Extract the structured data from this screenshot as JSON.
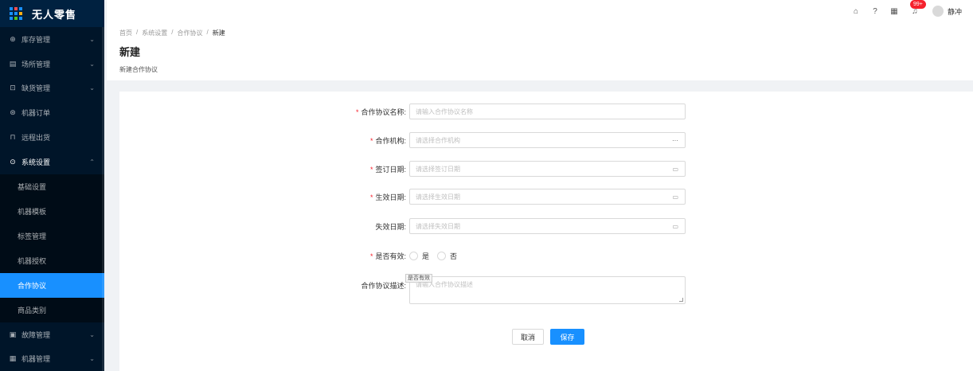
{
  "app": {
    "title": "无人零售"
  },
  "colors": {
    "sidebar_bg": "#001529",
    "accent": "#1890ff",
    "required": "#f5222d"
  },
  "sidebar": {
    "items": [
      {
        "label": "库存管理",
        "icon": "inventory-icon",
        "glyph": "⊕",
        "arrow": "⌄"
      },
      {
        "label": "场所管理",
        "icon": "location-icon",
        "glyph": "▤",
        "arrow": "⌄"
      },
      {
        "label": "缺货管理",
        "icon": "shortage-icon",
        "glyph": "⊡",
        "arrow": "⌄"
      },
      {
        "label": "机器订单",
        "icon": "order-icon",
        "glyph": "⊛",
        "arrow": ""
      },
      {
        "label": "远程出货",
        "icon": "remote-icon",
        "glyph": "⊓",
        "arrow": ""
      },
      {
        "label": "系统设置",
        "icon": "settings-icon",
        "glyph": "⊙",
        "arrow": "⌃"
      }
    ],
    "submenu": [
      {
        "label": "基础设置"
      },
      {
        "label": "机器模板"
      },
      {
        "label": "标签管理"
      },
      {
        "label": "机器授权"
      },
      {
        "label": "合作协议"
      },
      {
        "label": "商品类别"
      }
    ],
    "bottom_items": [
      {
        "label": "故障管理",
        "icon": "fault-icon",
        "glyph": "▣",
        "arrow": "⌄"
      },
      {
        "label": "机器管理",
        "icon": "machine-icon",
        "glyph": "▦",
        "arrow": "⌄"
      }
    ]
  },
  "header": {
    "badge": "99+",
    "username": "静冲",
    "icons": {
      "home": "⌂",
      "help": "?",
      "apps": "▦",
      "bell": "♫"
    }
  },
  "breadcrumb": {
    "b1": "首页",
    "b2": "系统设置",
    "b3": "合作协议",
    "b4": "新建",
    "sep": "/"
  },
  "page": {
    "title": "新建",
    "desc": "新建合作协议"
  },
  "form": {
    "name": {
      "label": "合作协议名称:",
      "placeholder": "请输入合作协议名称"
    },
    "org": {
      "label": "合作机构:",
      "placeholder": "请选择合作机构",
      "suffix": "···"
    },
    "sign_date": {
      "label": "签订日期:",
      "placeholder": "请选择签订日期"
    },
    "effective_date": {
      "label": "生效日期:",
      "placeholder": "请选择生效日期"
    },
    "expire_date": {
      "label": "失效日期:",
      "placeholder": "请选择失效日期"
    },
    "is_valid": {
      "label": "是否有效:",
      "yes": "是",
      "no": "否",
      "tooltip": "是否有效"
    },
    "desc": {
      "label": "合作协议描述:",
      "placeholder": "请输入合作协议描述"
    },
    "calendar_glyph": "▭",
    "required_mark": "*",
    "cancel": "取消",
    "save": "保存"
  }
}
